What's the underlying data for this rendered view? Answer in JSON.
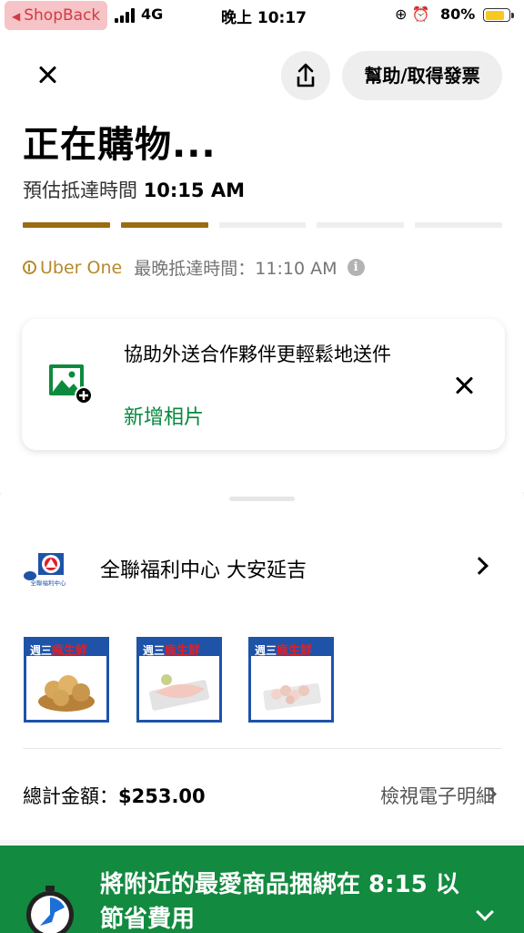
{
  "status_bar": {
    "back_app": "ShopBack",
    "network": "4G",
    "time": "晚上 10:17",
    "battery": "80%",
    "battery_level": 0.8
  },
  "header": {
    "help_label": "幫助/取得發票"
  },
  "order": {
    "title": "正在購物...",
    "eta_label": "預估抵達時間",
    "eta_time": "10:15 AM",
    "progress_steps_total": 5,
    "progress_steps_done": 2
  },
  "uber_one": {
    "brand": "Uber One",
    "latest_label": "最晚抵達時間：11:10 AM"
  },
  "photo_card": {
    "text": "協助外送合作夥伴更輕鬆地送件",
    "link": "新增相片"
  },
  "store": {
    "name": "全聯福利中心  大安延吉",
    "logo_caption": "全聯福利中心",
    "items": [
      {
        "tag_a": "週三",
        "tag_b": "瘋生鮮",
        "icon": "potatoes-image"
      },
      {
        "tag_a": "週三",
        "tag_b": "瘋生鮮",
        "icon": "fish-fillet-image"
      },
      {
        "tag_a": "週三",
        "tag_b": "瘋生鮮",
        "icon": "chicken-image"
      }
    ]
  },
  "summary": {
    "total_label": "總計金額：",
    "total_amount": "$253.00",
    "receipt_link": "檢視電子明細"
  },
  "banner": {
    "text": "將附近的最愛商品捆綁在 8:15 以節省費用"
  },
  "colors": {
    "accent_gold": "#9c6b12",
    "uber_one_gold": "#b6892b",
    "green": "#128a3f",
    "store_blue": "#1e53a8"
  }
}
